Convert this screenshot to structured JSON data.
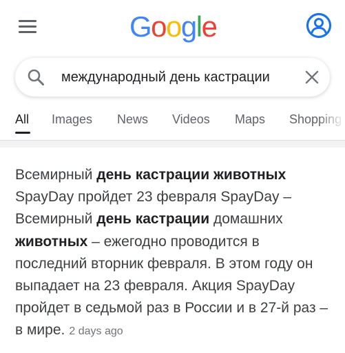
{
  "logo": {
    "letters": [
      "G",
      "o",
      "o",
      "g",
      "l",
      "e"
    ],
    "colors": [
      "#4285F4",
      "#EA4335",
      "#FBBC05",
      "#4285F4",
      "#34A853",
      "#EA4335"
    ]
  },
  "search": {
    "query": "международный день кастрации"
  },
  "tabs": [
    {
      "label": "All",
      "active": true
    },
    {
      "label": "Images",
      "active": false
    },
    {
      "label": "News",
      "active": false
    },
    {
      "label": "Videos",
      "active": false
    },
    {
      "label": "Maps",
      "active": false
    },
    {
      "label": "Shopping",
      "active": false
    }
  ],
  "result": {
    "segments": [
      {
        "text": "Всемирный ",
        "bold": false
      },
      {
        "text": "день кастрации животных",
        "bold": true
      },
      {
        "text": " SpayDay пройдет 23 февраля SpayDay – Всемирный ",
        "bold": false
      },
      {
        "text": "день кастрации",
        "bold": true
      },
      {
        "text": " домашних ",
        "bold": false
      },
      {
        "text": "животных",
        "bold": true
      },
      {
        "text": " – ежегодно проводится в последний вторник февраля. В этом году он выпадает на 23 февраля. Акция SpayDay пройдет в седьмой раз в России и в 27-й раз – в мире.",
        "bold": false
      }
    ],
    "date": "2 days ago"
  },
  "icons": {
    "menu": "hamburger-menu-icon",
    "account": "account-circle-icon",
    "search": "search-icon",
    "clear": "close-icon"
  },
  "colors": {
    "account_icon": "#1a73e8",
    "icon_gray": "#5f6368",
    "text_primary": "#202124",
    "text_secondary": "#5f6368"
  }
}
